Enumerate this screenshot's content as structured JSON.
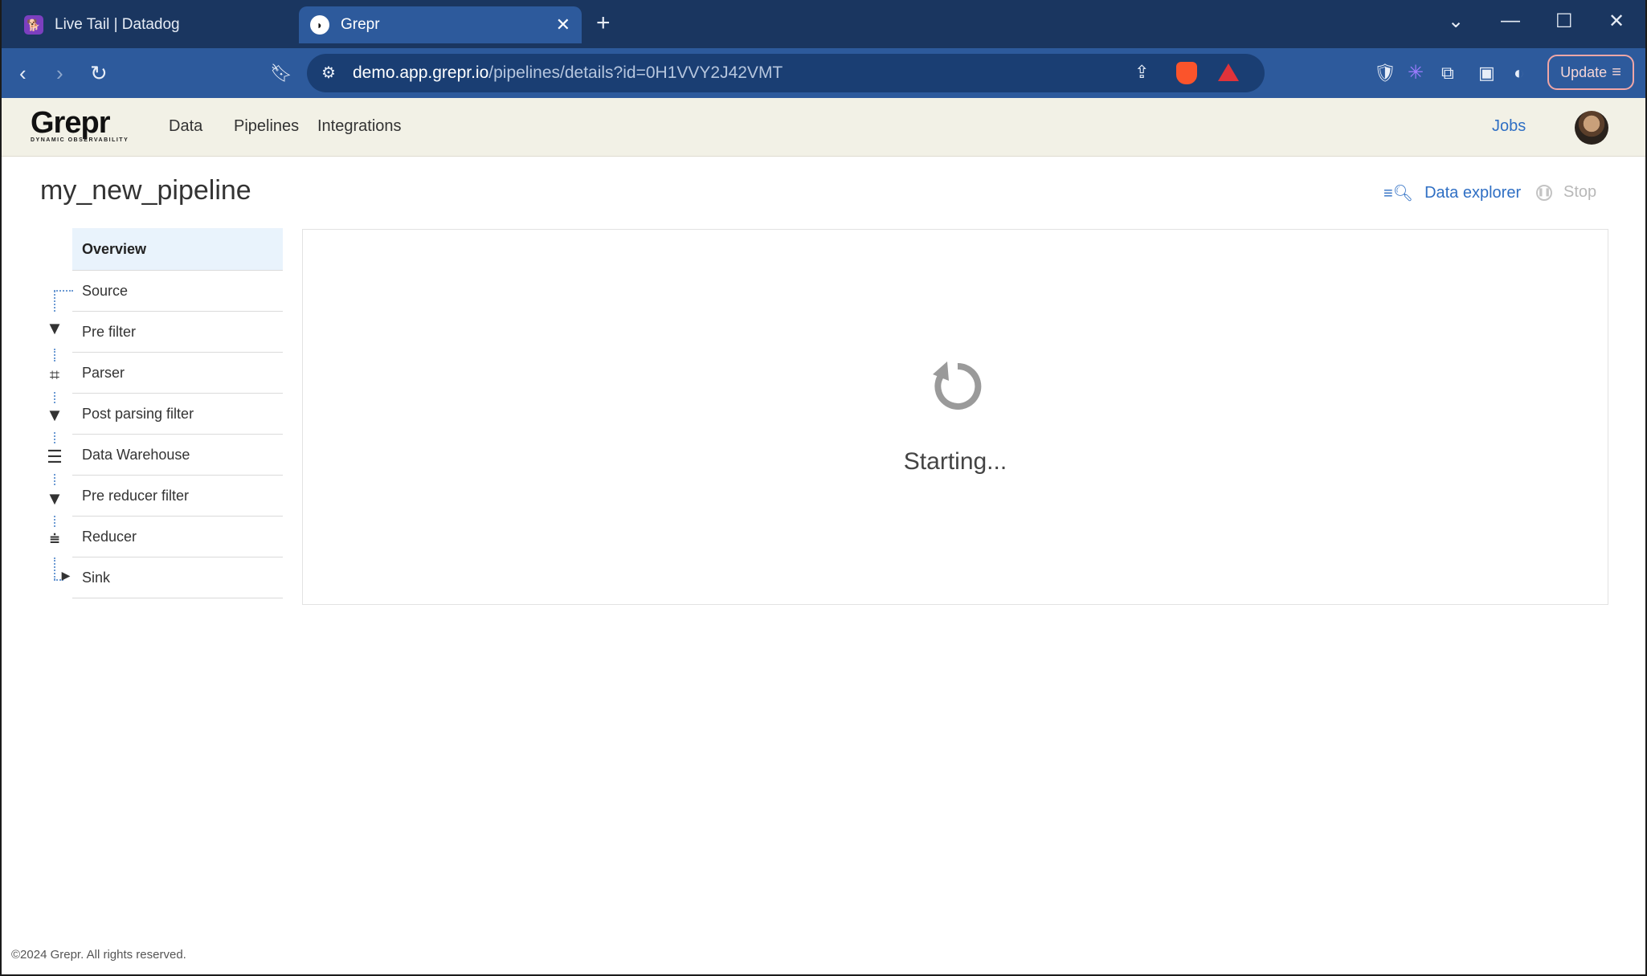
{
  "browser": {
    "tabs": [
      {
        "title": "Live Tail | Datadog",
        "active": false
      },
      {
        "title": "Grepr",
        "active": true
      }
    ],
    "url_host": "demo.app.grepr.io",
    "url_path": "/pipelines/details?id=0H1VVY2J42VMT",
    "update_label": "Update"
  },
  "app": {
    "logo_text": "Grepr",
    "logo_tagline": "DYNAMIC OBSERVABILITY",
    "nav": [
      "Data",
      "Pipelines",
      "Integrations"
    ],
    "jobs_label": "Jobs"
  },
  "page": {
    "title": "my_new_pipeline",
    "data_explorer_label": "Data explorer",
    "stop_label": "Stop",
    "steps": [
      {
        "label": "Overview",
        "icon": "none",
        "active": true
      },
      {
        "label": "Source",
        "icon": "dotted-connector-icon",
        "active": false
      },
      {
        "label": "Pre filter",
        "icon": "filter-icon",
        "active": false
      },
      {
        "label": "Parser",
        "icon": "crop-icon",
        "active": false
      },
      {
        "label": "Post parsing filter",
        "icon": "filter-icon",
        "active": false
      },
      {
        "label": "Data Warehouse",
        "icon": "list-icon",
        "active": false
      },
      {
        "label": "Pre reducer filter",
        "icon": "filter-icon",
        "active": false
      },
      {
        "label": "Reducer",
        "icon": "compress-icon",
        "active": false
      },
      {
        "label": "Sink",
        "icon": "arrow-right-icon",
        "active": false
      }
    ],
    "status_text": "Starting...",
    "footer": "©2024 Grepr. All rights reserved."
  },
  "colors": {
    "tabbar": "#1a3660",
    "toolbar": "#2d5a9c",
    "app_header": "#f2f1e6",
    "link": "#2f6fc4",
    "active_step": "#e9f3fc"
  }
}
